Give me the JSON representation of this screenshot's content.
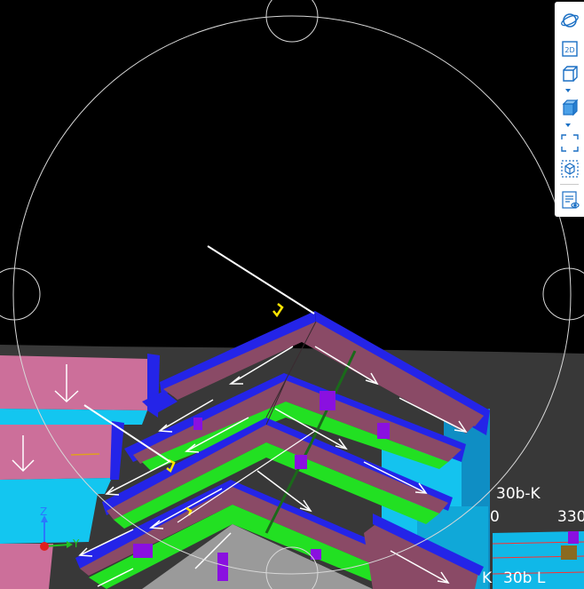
{
  "toolbar": {
    "items": [
      {
        "name": "orbit-icon"
      },
      {
        "name": "view-2d-icon",
        "label": "2D"
      },
      {
        "name": "view-3d-icon"
      },
      {
        "name": "view-dropdown-caret-icon"
      },
      {
        "name": "shaded-view-icon"
      },
      {
        "name": "shading-dropdown-caret-icon"
      },
      {
        "name": "fit-extents-icon"
      },
      {
        "name": "view-cube-icon"
      },
      {
        "name": "view-properties-icon"
      }
    ]
  },
  "scene": {
    "grid_labels": {
      "label_1": "30b-K",
      "label_2": "0",
      "label_3": "330",
      "label_4": "K",
      "label_5": "30b L"
    },
    "axes": {
      "x": "X",
      "y": "Y",
      "z": "Z"
    },
    "colors": {
      "background": "#000000",
      "roof_panel": "#8a4a66",
      "slab_pink": "#cc6f9a",
      "edge_blue": "#2222ee",
      "cyan": "#12c7f0",
      "green": "#22e022",
      "purple": "#8a10e0",
      "grey": "#9a9a9a",
      "ground": "#3a3a3a"
    }
  }
}
